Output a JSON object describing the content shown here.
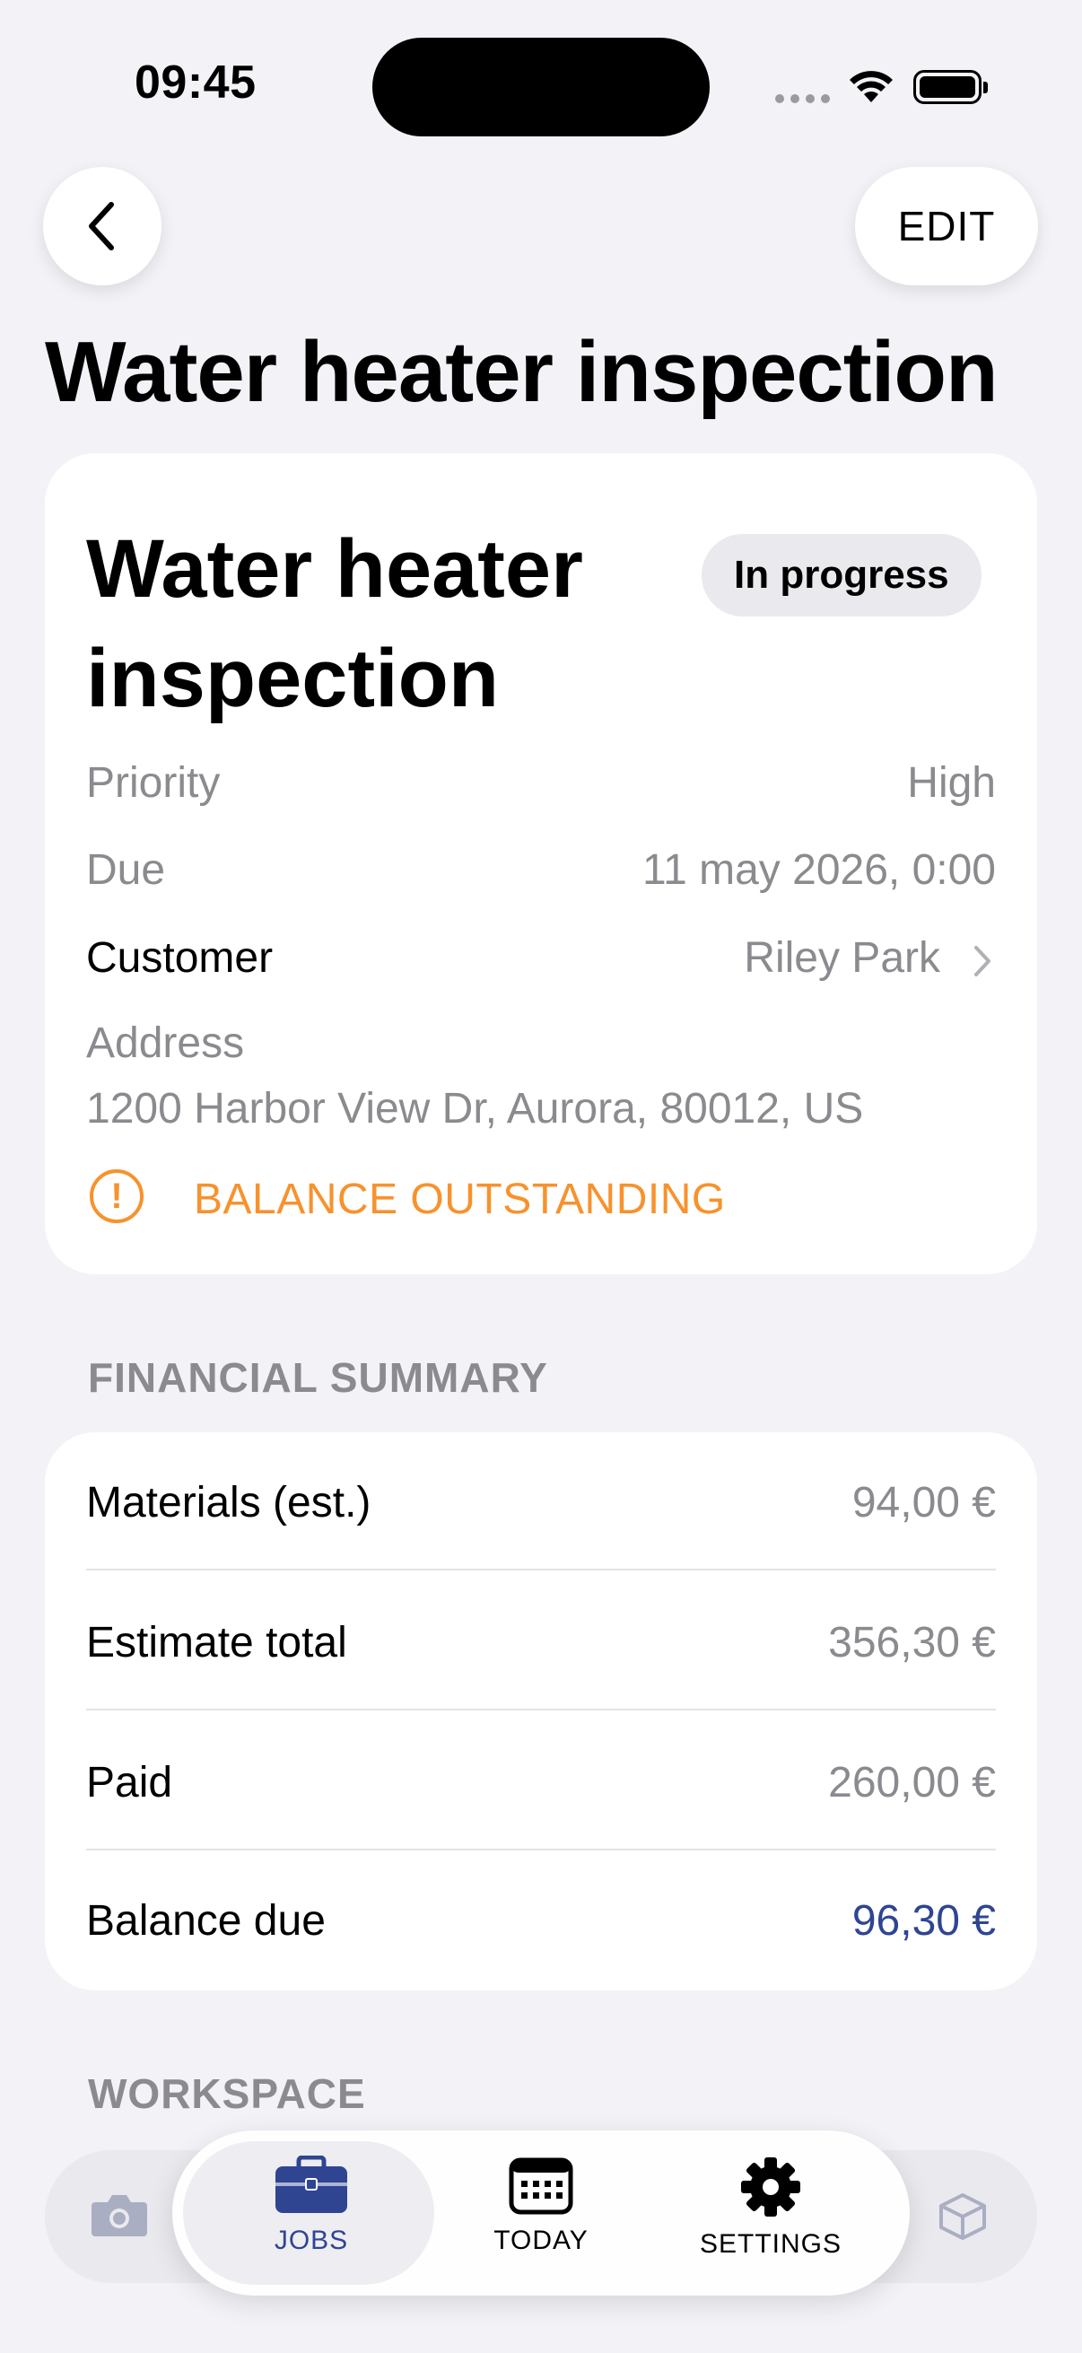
{
  "status_bar": {
    "time": "09:45"
  },
  "nav": {
    "edit_label": "EDIT"
  },
  "page_title": "Water heater inspection",
  "job": {
    "title": "Water heater inspection",
    "status": "In progress",
    "rows": [
      {
        "label": "Priority",
        "value": "High"
      },
      {
        "label": "Due",
        "value": "11 may 2026, 0:00"
      },
      {
        "label": "Customer",
        "value": "Riley Park"
      }
    ],
    "address_label": "Address",
    "address_value": "1200 Harbor View Dr, Aurora, 80012, US",
    "alert_text": "BALANCE OUTSTANDING"
  },
  "financial": {
    "header": "FINANCIAL SUMMARY",
    "rows": [
      {
        "label": "Materials (est.)",
        "value": "94,00 €"
      },
      {
        "label": "Estimate total",
        "value": "356,30 €"
      },
      {
        "label": "Paid",
        "value": "260,00 €"
      },
      {
        "label": "Balance due",
        "value": "96,30 €"
      }
    ]
  },
  "workspace": {
    "header": "WORKSPACE"
  },
  "tabbar": {
    "tabs": [
      {
        "label": "JOBS",
        "icon": "briefcase-icon",
        "active": true
      },
      {
        "label": "TODAY",
        "icon": "calendar-icon",
        "active": false
      },
      {
        "label": "SETTINGS",
        "icon": "gear-icon",
        "active": false
      }
    ]
  },
  "colors": {
    "accent": "#2F4592",
    "warning": "#F7922D",
    "background": "#F2F2F7",
    "secondary_text": "#8A8A8F"
  }
}
